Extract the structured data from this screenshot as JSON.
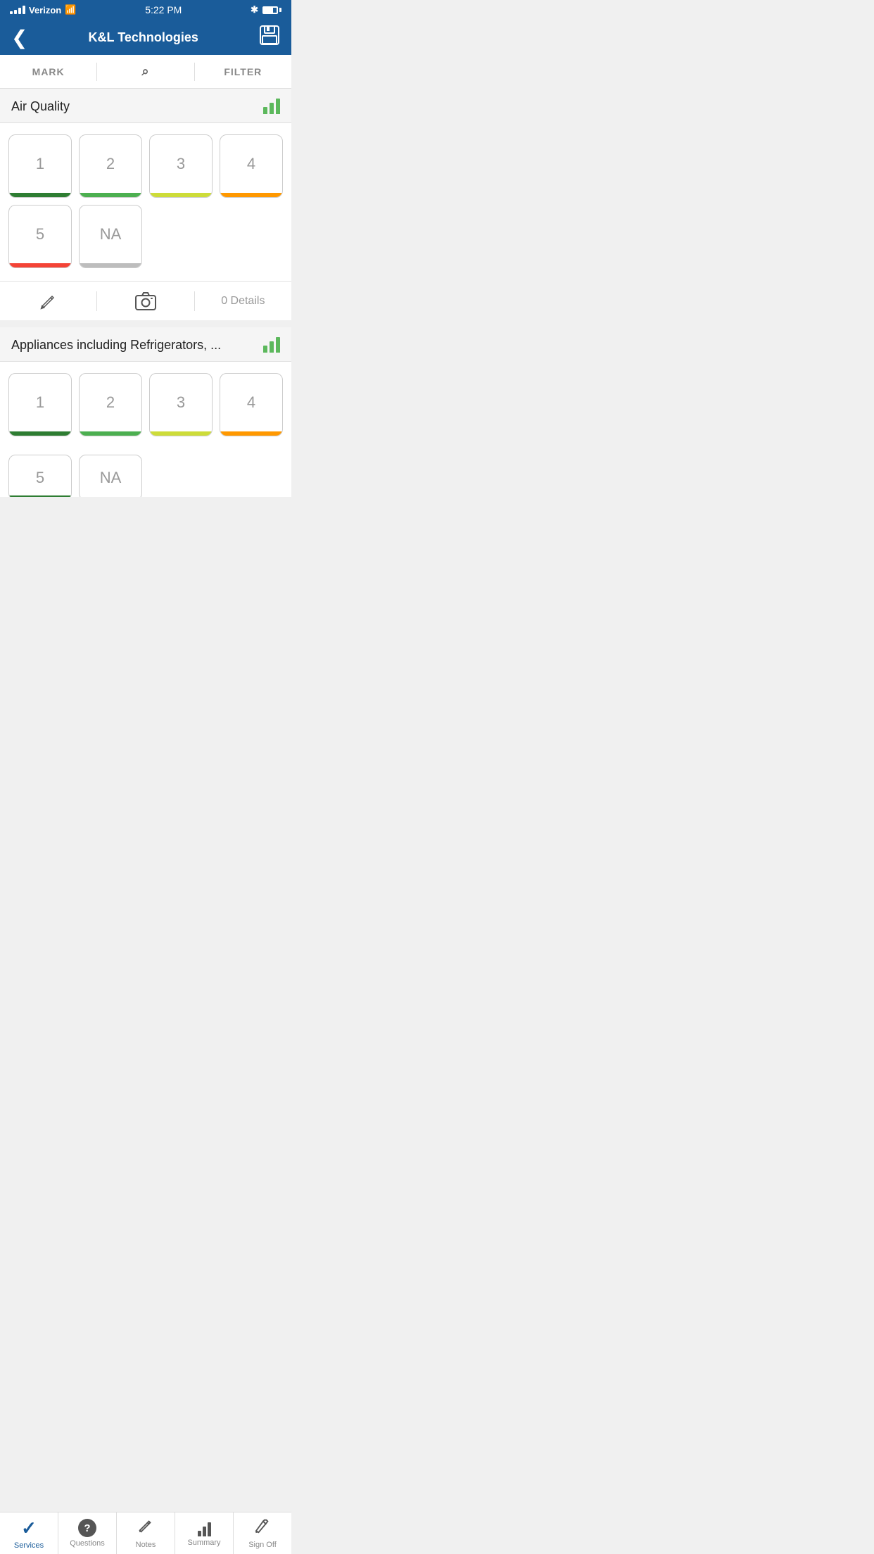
{
  "statusBar": {
    "carrier": "Verizon",
    "time": "5:22 PM",
    "bluetooth": "✱"
  },
  "navBar": {
    "title": "K&L Technologies",
    "backLabel": "‹",
    "saveLabel": "💾"
  },
  "toolbar": {
    "markLabel": "MARK",
    "filterLabel": "FILTER"
  },
  "sections": [
    {
      "id": "air-quality",
      "title": "Air Quality",
      "ratings": [
        {
          "value": "1",
          "colorClass": "green"
        },
        {
          "value": "2",
          "colorClass": "green2"
        },
        {
          "value": "3",
          "colorClass": "yellow"
        },
        {
          "value": "4",
          "colorClass": "orange"
        },
        {
          "value": "5",
          "colorClass": "red"
        },
        {
          "value": "NA",
          "colorClass": "na"
        }
      ],
      "detailsCount": "0 Details"
    },
    {
      "id": "appliances",
      "title": "Appliances including Refrigerators, ...",
      "ratings": [
        {
          "value": "1",
          "colorClass": "green"
        },
        {
          "value": "2",
          "colorClass": "green2"
        },
        {
          "value": "3",
          "colorClass": "yellow"
        },
        {
          "value": "4",
          "colorClass": "orange"
        },
        {
          "value": "5",
          "colorClass": "red"
        },
        {
          "value": "NA",
          "colorClass": "na"
        }
      ]
    }
  ],
  "tabBar": {
    "items": [
      {
        "id": "services",
        "label": "Services",
        "active": true
      },
      {
        "id": "questions",
        "label": "Questions",
        "active": false
      },
      {
        "id": "notes",
        "label": "Notes",
        "active": false
      },
      {
        "id": "summary",
        "label": "Summary",
        "active": false
      },
      {
        "id": "signoff",
        "label": "Sign Off",
        "active": false
      }
    ]
  }
}
